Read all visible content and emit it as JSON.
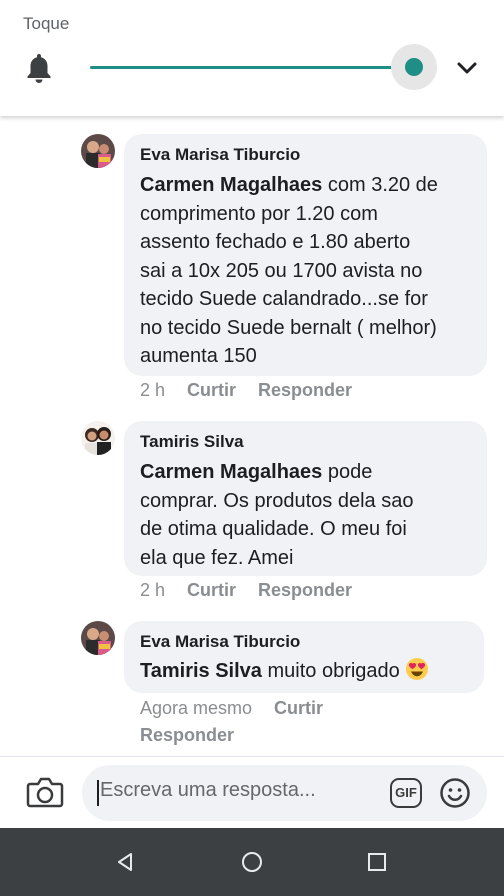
{
  "volume_panel": {
    "title": "Toque",
    "level": 1.0,
    "accent_color": "#1f8f86",
    "icons": {
      "mode": "bell-icon",
      "expand": "chevron-down-icon"
    }
  },
  "comments": [
    {
      "author": "Eva Marisa Tiburcio",
      "mention": "Carmen Magalhaes",
      "lines": [
        " com 3.20 de",
        "comprimento por 1.20 com",
        "assento fechado e 1.80 aberto",
        "sai a 10x 205 ou 1700 avista no",
        "tecido Suede calandrado...se for",
        "no tecido Suede bernalt ( melhor)",
        "aumenta 150"
      ],
      "time": "2 h",
      "like_label": "Curtir",
      "reply_label": "Responder"
    },
    {
      "author": "Tamiris Silva",
      "mention": "Carmen Magalhaes",
      "lines": [
        " pode",
        "comprar. Os produtos dela sao",
        "de otima qualidade. O meu foi",
        "ela que fez. Amei"
      ],
      "time": "2 h",
      "like_label": "Curtir",
      "reply_label": "Responder"
    },
    {
      "author": "Eva Marisa Tiburcio",
      "mention": "Tamiris Silva",
      "lines": [
        " muito obrigado "
      ],
      "emoji": "heart-eyes-emoji",
      "time": "Agora mesmo",
      "like_label": "Curtir",
      "reply_label": "Responder"
    }
  ],
  "composer": {
    "placeholder": "Escreva uma resposta...",
    "gif_label": "GIF",
    "icons": {
      "camera": "camera-icon",
      "emoji": "smiley-icon"
    }
  },
  "nav": {
    "icons": [
      "back-icon",
      "home-icon",
      "recents-icon"
    ]
  }
}
